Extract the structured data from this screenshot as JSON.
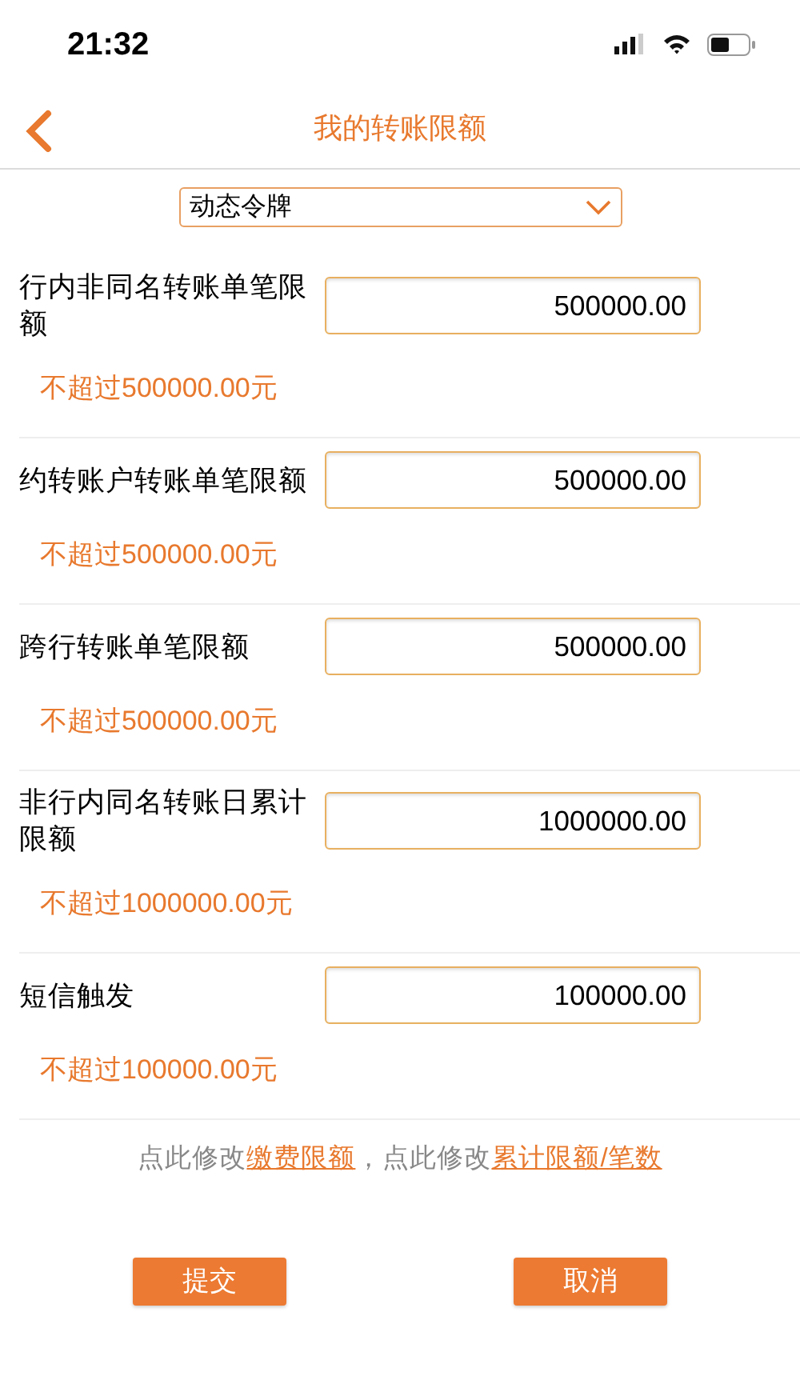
{
  "status_bar": {
    "time": "21:32"
  },
  "nav": {
    "title": "我的转账限额"
  },
  "token_select": {
    "value": "动态令牌"
  },
  "limits": [
    {
      "label": "行内非同名转账单笔限额",
      "value": "500000.00",
      "hint": "不超过500000.00元"
    },
    {
      "label": "约转账户转账单笔限额",
      "value": "500000.00",
      "hint": "不超过500000.00元"
    },
    {
      "label": "跨行转账单笔限额",
      "value": "500000.00",
      "hint": "不超过500000.00元"
    },
    {
      "label": "非行内同名转账日累计限额",
      "value": "1000000.00",
      "hint": "不超过1000000.00元"
    },
    {
      "label": "短信触发",
      "value": "100000.00",
      "hint": "不超过100000.00元"
    }
  ],
  "footer_note": [
    {
      "kind": "text",
      "text": "点此修改"
    },
    {
      "kind": "link",
      "text": "缴费限额"
    },
    {
      "kind": "text",
      "text": "，点此修改"
    },
    {
      "kind": "link",
      "text": "累计限额/笔数"
    }
  ],
  "buttons": [
    {
      "label": "提交"
    },
    {
      "label": "取消"
    }
  ]
}
